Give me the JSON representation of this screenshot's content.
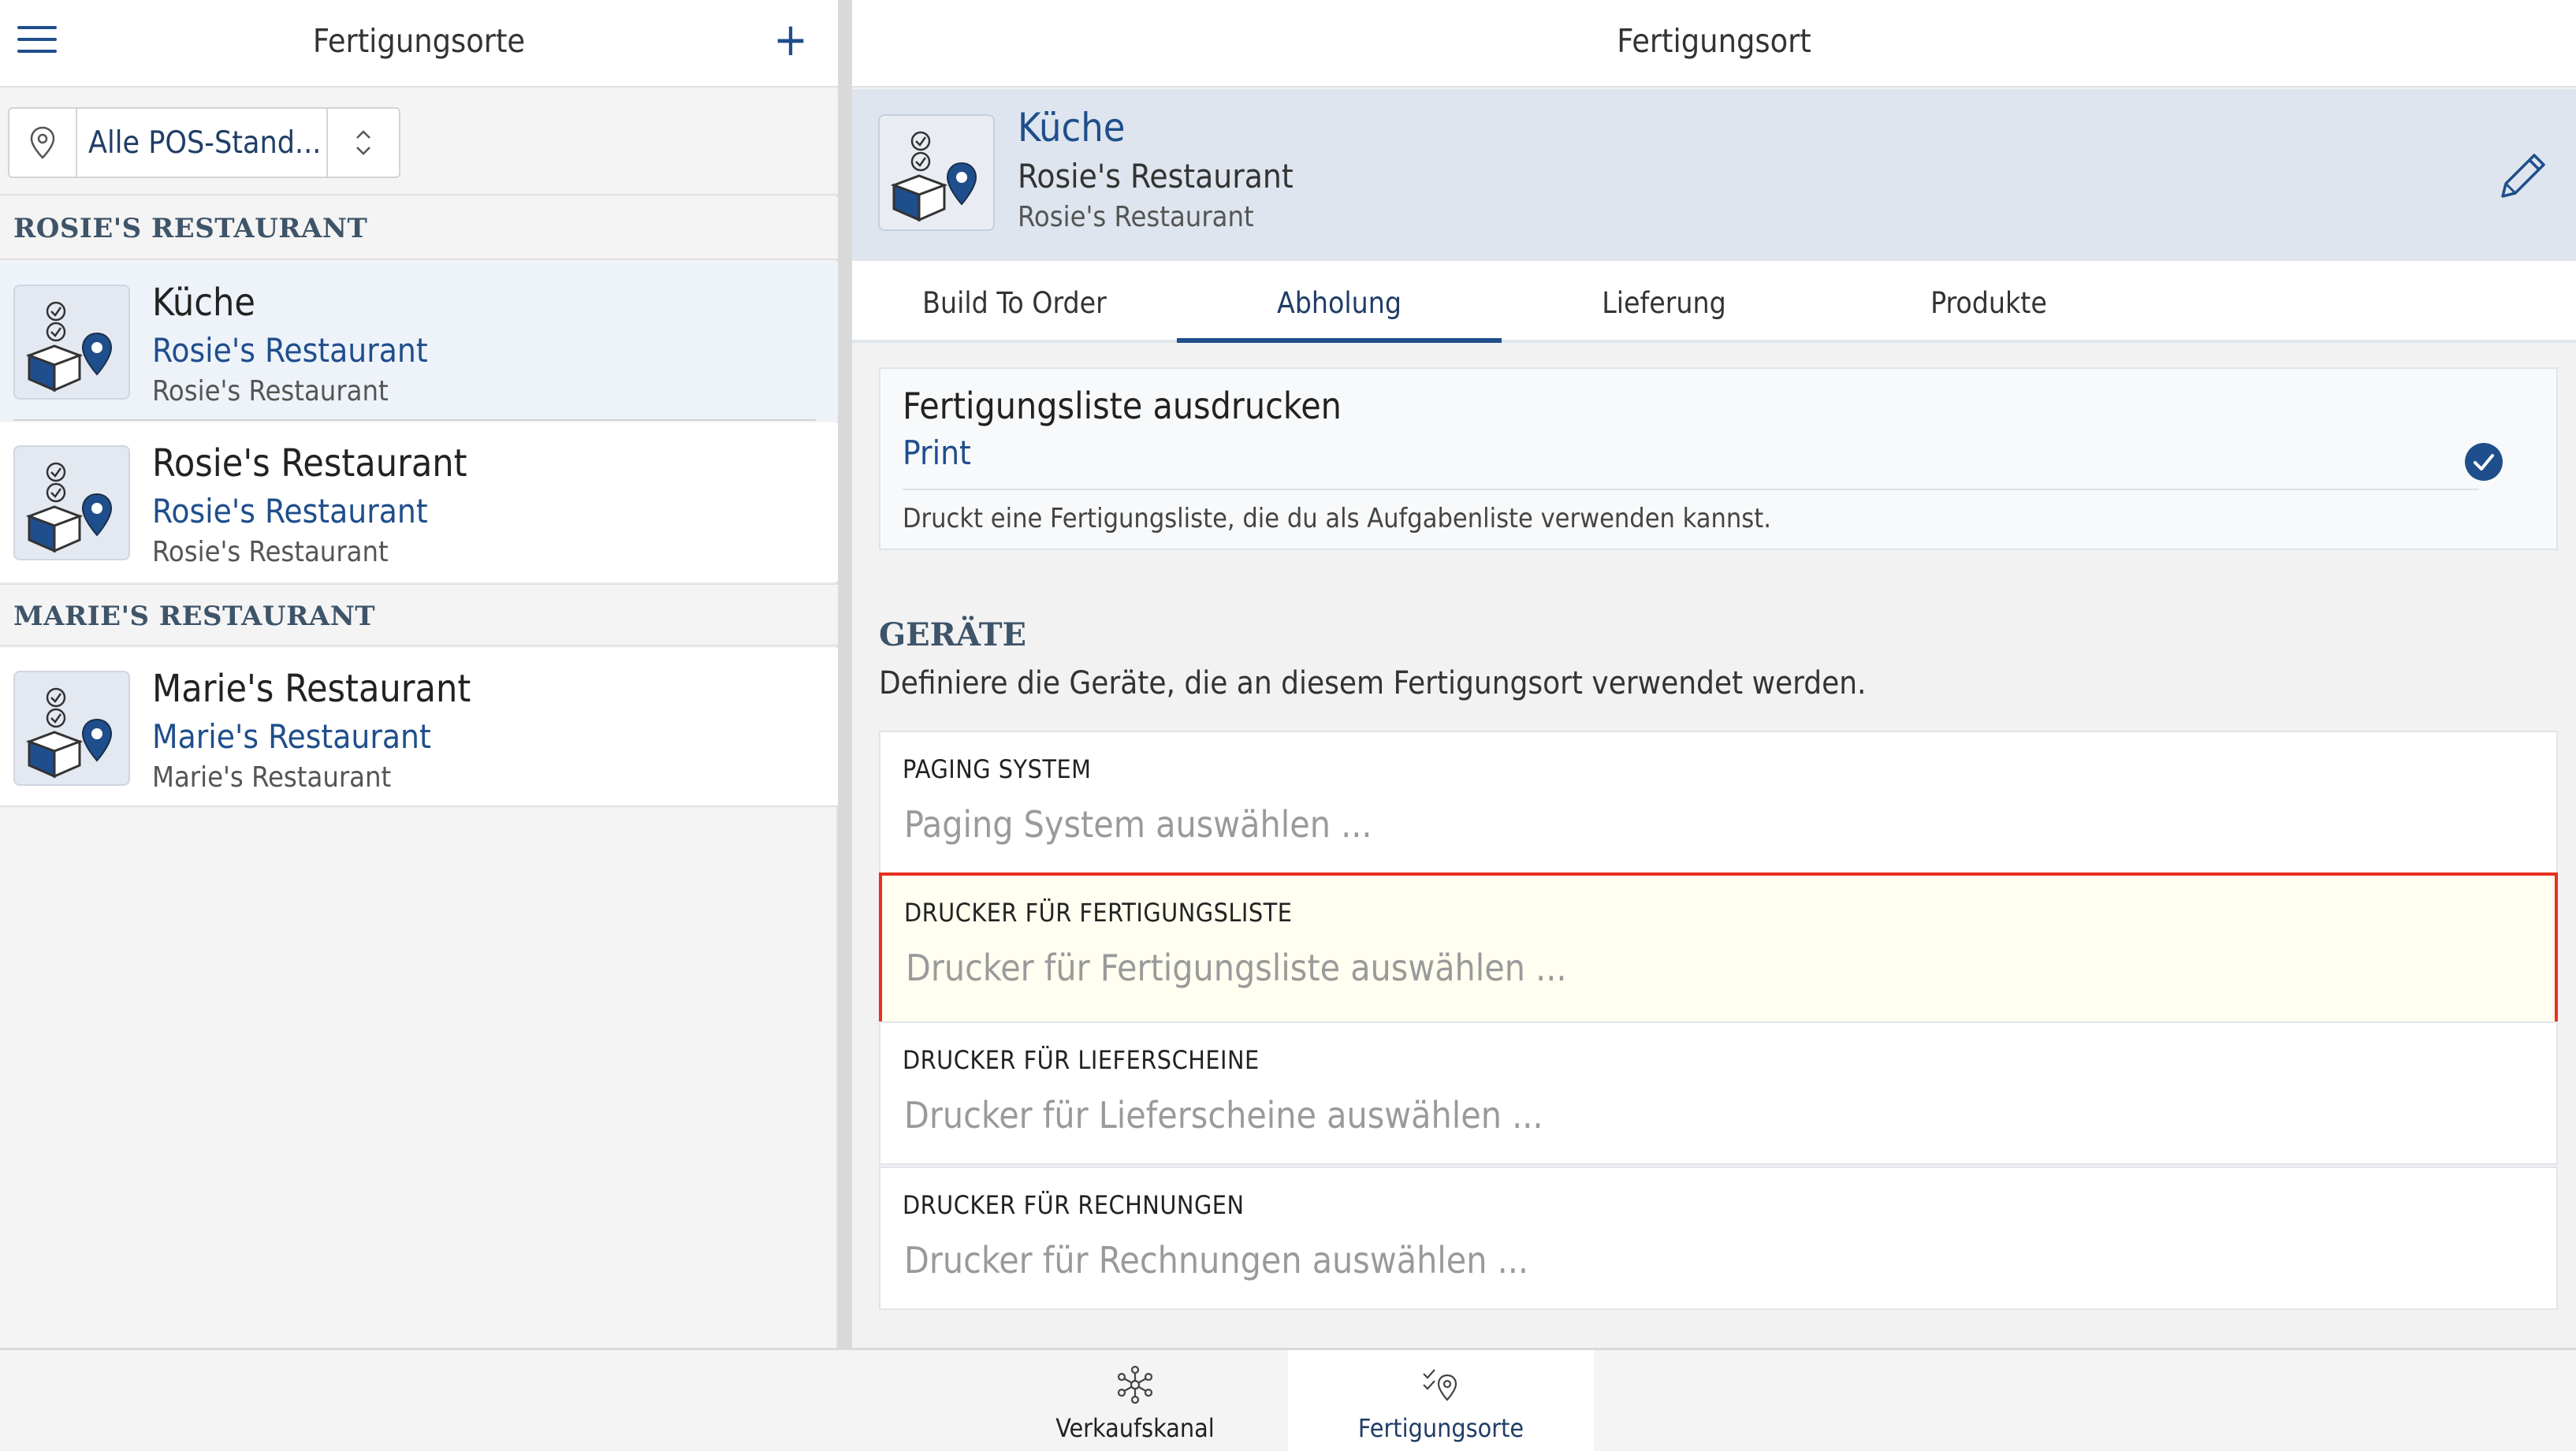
{
  "left": {
    "title": "Fertigungsorte",
    "filter_value": "Alle POS-Stand...",
    "groups": [
      {
        "label": "ROSIE'S RESTAURANT",
        "items": [
          {
            "title": "Küche",
            "subtitle": "Rosie's Restaurant",
            "meta": "Rosie's Restaurant",
            "selected": true
          },
          {
            "title": "Rosie's Restaurant",
            "subtitle": "Rosie's Restaurant",
            "meta": "Rosie's Restaurant",
            "selected": false
          }
        ]
      },
      {
        "label": "MARIE'S RESTAURANT",
        "items": [
          {
            "title": "Marie's Restaurant",
            "subtitle": "Marie's Restaurant",
            "meta": "Marie's Restaurant",
            "selected": false
          }
        ]
      }
    ]
  },
  "right": {
    "title": "Fertigungsort",
    "detail": {
      "name": "Küche",
      "subtitle": "Rosie's Restaurant",
      "meta": "Rosie's Restaurant"
    },
    "tabs": [
      {
        "label": "Build To Order",
        "active": false
      },
      {
        "label": "Abholung",
        "active": true
      },
      {
        "label": "Lieferung",
        "active": false
      },
      {
        "label": "Produkte",
        "active": false
      }
    ],
    "print_card": {
      "title": "Fertigungsliste ausdrucken",
      "value": "Print",
      "description": "Druckt eine Fertigungsliste, die du als Aufgabenliste verwenden kannst.",
      "checked": true
    },
    "devices": {
      "title": "GERÄTE",
      "subtitle": "Definiere die Geräte, die an diesem Fertigungsort verwendet werden.",
      "fields": [
        {
          "label": "PAGING SYSTEM",
          "placeholder": "Paging System auswählen ...",
          "highlighted": false
        },
        {
          "label": "DRUCKER FÜR FERTIGUNGSLISTE",
          "placeholder": "Drucker für Fertigungsliste auswählen ...",
          "highlighted": true
        },
        {
          "label": "DRUCKER FÜR LIEFERSCHEINE",
          "placeholder": "Drucker für Lieferscheine auswählen ...",
          "highlighted": false
        },
        {
          "label": "DRUCKER FÜR RECHNUNGEN",
          "placeholder": "Drucker für Rechnungen auswählen ...",
          "highlighted": false
        }
      ]
    }
  },
  "bottom_nav": [
    {
      "label": "Verkaufskanal",
      "icon": "snowflake-network-icon",
      "active": false
    },
    {
      "label": "Fertigungsorte",
      "icon": "location-check-icon",
      "active": true
    }
  ],
  "colors": {
    "accent": "#1f4e8c",
    "highlight_border": "#e8311f",
    "highlight_bg": "#fffef0"
  }
}
